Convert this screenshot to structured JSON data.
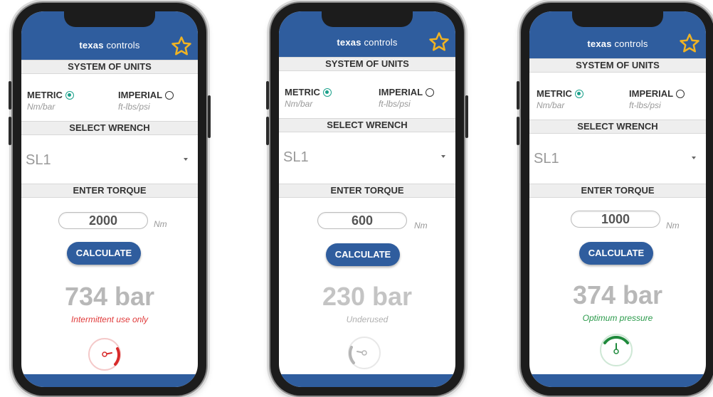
{
  "app": {
    "brand_bold": "texas",
    "brand_rest": " controls"
  },
  "labels": {
    "units_title": "SYSTEM OF UNITS",
    "metric": "METRIC",
    "metric_sub": "Nm/bar",
    "imperial": "IMPERIAL",
    "imperial_sub": "ft-lbs/psi",
    "wrench_title": "SELECT WRENCH",
    "torque_title": "ENTER TORQUE",
    "torque_unit": "Nm",
    "calculate": "CALCULATE"
  },
  "icons": {
    "favorite": "star-icon",
    "gauge": "gauge-icon"
  },
  "colors": {
    "brand": "#2f5d9e",
    "star": "#f0b323",
    "metric_selected": "#1aa08a"
  },
  "phones": [
    {
      "wrench": "SL1",
      "torque": "2000",
      "result": "734 bar",
      "status": "Intermittent use only",
      "status_color": "#e03a3a",
      "gauge_level": "high"
    },
    {
      "wrench": "SL1",
      "torque": "600",
      "result": "230 bar",
      "status": "Underused",
      "status_color": "#b0b0b0",
      "gauge_level": "low"
    },
    {
      "wrench": "SL1",
      "torque": "1000",
      "result": "374 bar",
      "status": "Optimum pressure",
      "status_color": "#2a9a4a",
      "gauge_level": "mid"
    }
  ]
}
